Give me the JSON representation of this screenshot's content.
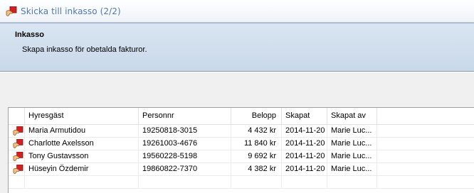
{
  "window": {
    "title": "Skicka till inkasso (2/2)"
  },
  "header": {
    "title": "Inkasso",
    "description": "Skapa inkasso för obetalda fakturor."
  },
  "table": {
    "columns": [
      "Hyresgäst",
      "Personnr",
      "Belopp",
      "Skapat",
      "Skapat av"
    ],
    "rows": [
      {
        "icon": "invoice-icon",
        "tenant": "Maria Armutidou",
        "personnr": "19250818-3015",
        "amount": "4 432 kr",
        "created": "2014-11-20",
        "created_by": "Marie Luc..."
      },
      {
        "icon": "invoice-icon",
        "tenant": "Charlotte Axelsson",
        "personnr": "19261003-4676",
        "amount": "11 840 kr",
        "created": "2014-11-20",
        "created_by": "Marie Luc..."
      },
      {
        "icon": "invoice-icon",
        "tenant": "Tony Gustavsson",
        "personnr": "19560228-5198",
        "amount": "9 692 kr",
        "created": "2014-11-20",
        "created_by": "Marie Luc..."
      },
      {
        "icon": "invoice-icon",
        "tenant": "Hüseyin Özdemir",
        "personnr": "19860822-7370",
        "amount": "4 382 kr",
        "created": "2014-11-20",
        "created_by": "Marie Luc..."
      }
    ]
  },
  "colors": {
    "title_text": "#4f79b4",
    "header_bg": "#cfdcec",
    "icon_red": "#d42020"
  }
}
